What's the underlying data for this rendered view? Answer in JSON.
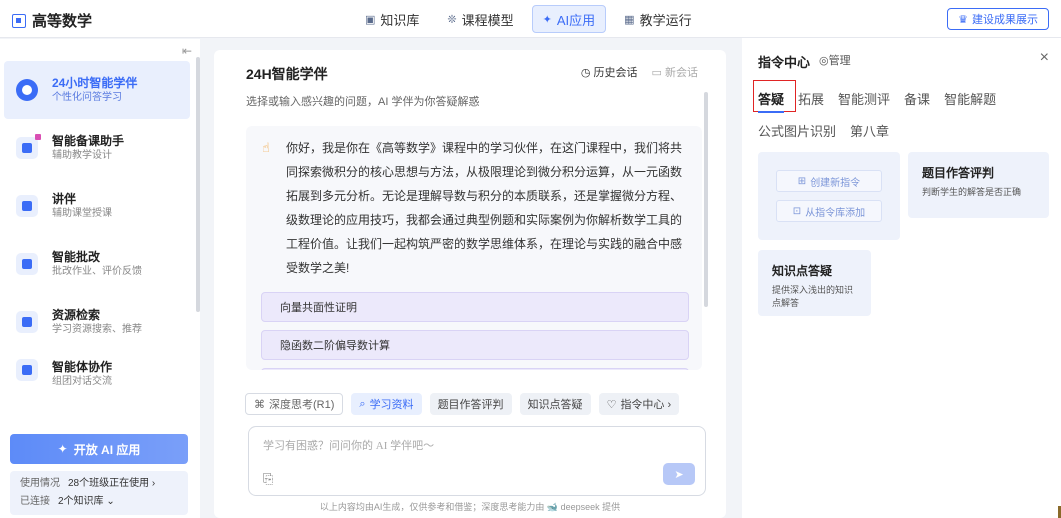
{
  "header": {
    "title": "高等数学",
    "nav": [
      {
        "label": "知识库",
        "icon": "book-icon"
      },
      {
        "label": "课程模型",
        "icon": "network-icon"
      },
      {
        "label": "AI应用",
        "icon": "sparkle-icon"
      },
      {
        "label": "教学运行",
        "icon": "grid-icon"
      }
    ],
    "active_nav": "AI应用",
    "showcase_label": "建设成果展示"
  },
  "sidebar": {
    "items": [
      {
        "title": "24小时智能学伴",
        "subtitle": "个性化问答学习"
      },
      {
        "title": "智能备课助手",
        "subtitle": "辅助教学设计"
      },
      {
        "title": "讲伴",
        "subtitle": "辅助课堂授课"
      },
      {
        "title": "智能批改",
        "subtitle": "批改作业、评价反馈"
      },
      {
        "title": "资源检索",
        "subtitle": "学习资源搜索、推荐"
      },
      {
        "title": "智能体协作",
        "subtitle": "组团对话交流"
      }
    ],
    "open_ai_label": "开放 AI 应用",
    "usage_label": "使用情况",
    "usage_value": "28个班级正在使用 ›",
    "connected_label": "已连接",
    "connected_value": "2个知识库 ⌄"
  },
  "main": {
    "title": "24H智能学伴",
    "history_label": "历史会话",
    "new_chat_label": "新会话",
    "subtitle": "选择或输入感兴趣的问题，AI 学伴为你答疑解惑",
    "greeting": "你好，我是你在《高等数学》课程中的学习伙伴，在这门课程中，我们将共同探索微积分的核心思想与方法，从极限理论到微分积分运算，从一元函数拓展到多元分析。无论是理解导数与积分的本质联系，还是掌握微分方程、级数理论的应用技巧，我都会通过典型例题和实际案例为你解析数学工具的工程价值。让我们一起构筑严密的数学思维体系，在理论与实践的融合中感受数学之美!",
    "suggestions": [
      "向量共面性证明",
      "隐函数二阶偏导数计算",
      ""
    ],
    "chips": {
      "deep_think": "深度思考(R1)",
      "study_material": "学习资料",
      "grading": "题目作答评判",
      "kp_answer": "知识点答疑",
      "command_center": "指令中心 ›"
    },
    "input_placeholder": "学习有困惑？问问你的 AI 学伴吧～",
    "footer_note": "以上内容均由AI生成，仅供参考和借鉴；深度思考能力由 🐋 deepseek 提供"
  },
  "right_panel": {
    "title": "指令中心",
    "manage_label": "◎管理",
    "tabs": [
      "答疑",
      "拓展",
      "智能测评",
      "备课",
      "智能解题",
      "公式图片识别",
      "第八章"
    ],
    "active_tab": "答疑",
    "create_label": "创建新指令",
    "add_label": "从指令库添加",
    "cards": [
      {
        "title": "题目作答评判",
        "desc": "判断学生的解答是否正确"
      },
      {
        "title": "知识点答疑",
        "desc": "提供深入浅出的知识点解答"
      }
    ]
  }
}
